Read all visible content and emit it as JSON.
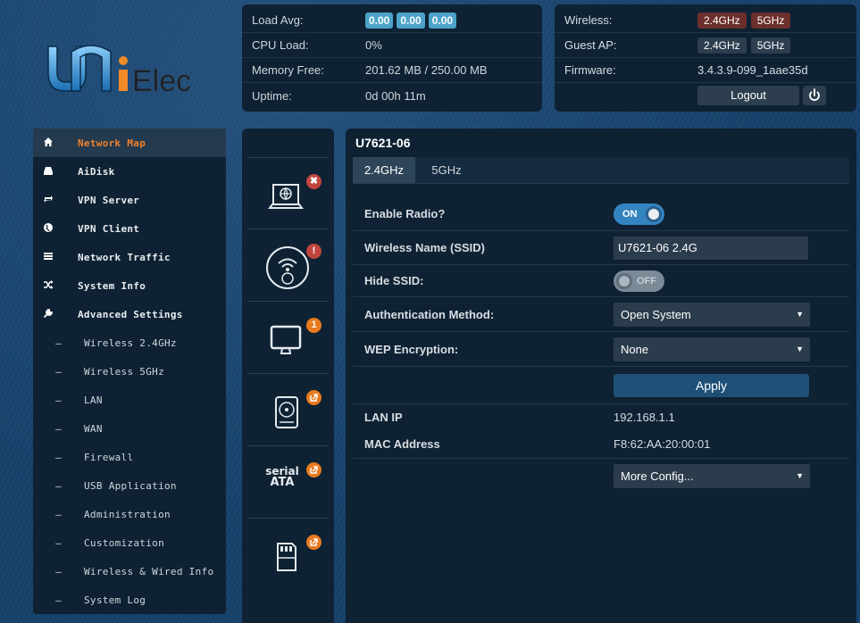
{
  "logo": {
    "text_u": "U",
    "text_ni": "ni",
    "text_elec": "Elec"
  },
  "status": {
    "load_avg_label": "Load Avg:",
    "load_avg": [
      "0.00",
      "0.00",
      "0.00"
    ],
    "cpu_label": "CPU Load:",
    "cpu_value": "0%",
    "memory_label": "Memory Free:",
    "memory_value": "201.62 MB / 250.00 MB",
    "uptime_label": "Uptime:",
    "uptime_value": "0d 00h 11m"
  },
  "wireless_status": {
    "wireless_label": "Wireless:",
    "guest_label": "Guest AP:",
    "band_24": "2.4GHz",
    "band_5": "5GHz",
    "firmware_label": "Firmware:",
    "firmware_value": "3.4.3.9-099_1aae35d",
    "logout": "Logout"
  },
  "sidebar": {
    "items": [
      {
        "label": "Network Map",
        "icon": "home-icon",
        "active": true
      },
      {
        "label": "AiDisk",
        "icon": "disk-icon"
      },
      {
        "label": "VPN Server",
        "icon": "vpn-server-icon"
      },
      {
        "label": "VPN Client",
        "icon": "globe-icon"
      },
      {
        "label": "Network Traffic",
        "icon": "traffic-icon"
      },
      {
        "label": "System Info",
        "icon": "shuffle-icon"
      },
      {
        "label": "Advanced Settings",
        "icon": "wrench-icon"
      }
    ],
    "subitems": [
      "Wireless 2.4GHz",
      "Wireless 5GHz",
      "LAN",
      "WAN",
      "Firewall",
      "USB Application",
      "Administration",
      "Customization",
      "Wireless & Wired Info",
      "System Log"
    ]
  },
  "icon_column": {
    "cells": [
      {
        "icon": "internet-laptop-icon",
        "badge": "✖",
        "badge_color": "#c0453d"
      },
      {
        "icon": "wireless-router-icon",
        "badge": "!",
        "badge_color": "#c0453d"
      },
      {
        "icon": "monitor-icon",
        "badge": "1",
        "badge_color": "#e87a1e"
      },
      {
        "icon": "hdd-icon",
        "badge": "external-link-icon",
        "badge_color": "#e87a1e"
      },
      {
        "icon": "serial-ata-icon",
        "label_top": "serial",
        "label_bottom": "ATA",
        "badge": "external-link-icon",
        "badge_color": "#e87a1e"
      },
      {
        "icon": "sd-card-icon",
        "badge": "external-link-icon",
        "badge_color": "#e87a1e"
      }
    ]
  },
  "main": {
    "title": "U7621-06",
    "tabs": [
      "2.4GHz",
      "5GHz"
    ],
    "enable_radio_label": "Enable Radio?",
    "enable_radio_state": "ON",
    "ssid_label": "Wireless Name (SSID)",
    "ssid_value": "U7621-06 2.4G",
    "hide_ssid_label": "Hide SSID:",
    "hide_ssid_state": "OFF",
    "auth_label": "Authentication Method:",
    "auth_value": "Open System",
    "wep_label": "WEP Encryption:",
    "wep_value": "None",
    "apply": "Apply",
    "lan_ip_label": "LAN IP",
    "lan_ip_value": "192.168.1.1",
    "mac_label": "MAC Address",
    "mac_value": "F8:62:AA:20:00:01",
    "more_config": "More Config..."
  },
  "colors": {
    "accent_orange": "#f0812f",
    "badge_red": "#c0453d",
    "toggle_blue": "#3484c1",
    "panel_bg": "#0e2233"
  }
}
